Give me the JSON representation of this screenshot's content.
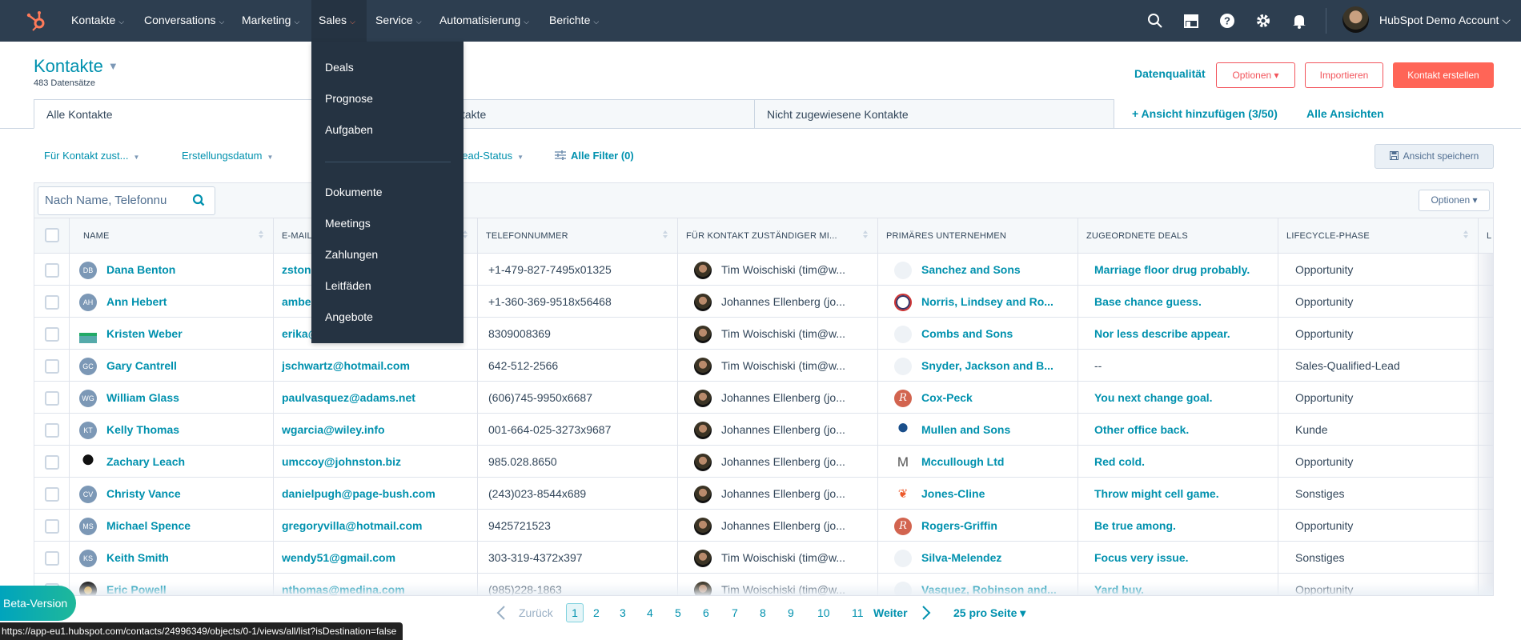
{
  "nav": {
    "items": [
      {
        "label": "Kontakte"
      },
      {
        "label": "Conversations"
      },
      {
        "label": "Marketing"
      },
      {
        "label": "Sales"
      },
      {
        "label": "Service"
      },
      {
        "label": "Automatisierung"
      },
      {
        "label": "Berichte"
      }
    ],
    "chevron": "⌵",
    "account": "HubSpot Demo Account ⌵",
    "icons": [
      "search-icon",
      "marketplace-icon",
      "help-icon",
      "settings-icon",
      "notifications-icon"
    ]
  },
  "sales_menu": {
    "group1": [
      "Deals",
      "Prognose",
      "Aufgaben"
    ],
    "group2": [
      "Dokumente",
      "Meetings",
      "Zahlungen",
      "Leitfäden",
      "Angebote"
    ]
  },
  "header": {
    "title": "Kontakte",
    "caret": "▼",
    "record_count": "483 Datensätze",
    "data_quality": "Datenqualität",
    "options": "Optionen ▾",
    "import": "Importieren",
    "create": "Kontakt erstellen"
  },
  "tabs": {
    "items": [
      "Alle Kontakte",
      "Meine Kontakte",
      "Nicht zugewiesene Kontakte"
    ],
    "add_view": "+  Ansicht hinzufügen (3/50)",
    "all_views": "Alle Ansichten"
  },
  "filters": {
    "items": [
      "Für Kontakt zust...",
      "Erstellungsdatum",
      "Lead-Status"
    ],
    "caret": "▼",
    "all_filters": "Alle Filter (0)",
    "save_view": "Ansicht speichern"
  },
  "table": {
    "search_placeholder": "Nach Name, Telefonnu",
    "options": "Optionen ▾",
    "columns": [
      "NAME",
      "E-MAIL",
      "TELEFONNUMMER",
      "FÜR KONTAKT ZUSTÄNDIGER MI...",
      "PRIMÄRES UNTERNEHMEN",
      "ZUGEORDNETE DEALS",
      "LIFECYCLE-PHASE",
      "L"
    ],
    "rows": [
      {
        "initials": "DB",
        "name": "Dana Benton",
        "email": "zstone@example.com",
        "phone": "+1-479-827-7495x01325",
        "owner": "Tim Woischiski (tim@w...",
        "company": "Sanchez and Sons",
        "deal": "Marriage floor drug probably.",
        "stage": "Opportunity"
      },
      {
        "initials": "AH",
        "name": "Ann Hebert",
        "email": "amber@example.com",
        "phone": "+1-360-369-9518x56468",
        "owner": "Johannes Ellenberg (jo...",
        "company": "Norris, Lindsey and Ro...",
        "deal": "Base chance guess.",
        "stage": "Opportunity"
      },
      {
        "initials": "",
        "name": "Kristen Weber",
        "email": "erika@example.com",
        "phone": "8309008369",
        "owner": "Tim Woischiski (tim@w...",
        "company": "Combs and Sons",
        "deal": "Nor less describe appear.",
        "stage": "Opportunity"
      },
      {
        "initials": "GC",
        "name": "Gary Cantrell",
        "email": "jschwartz@hotmail.com",
        "phone": "642-512-2566",
        "owner": "Tim Woischiski (tim@w...",
        "company": "Snyder, Jackson and B...",
        "deal": "--",
        "stage": "Sales-Qualified-Lead"
      },
      {
        "initials": "WG",
        "name": "William Glass",
        "email": "paulvasquez@adams.net",
        "phone": "(606)745-9950x6687",
        "owner": "Johannes Ellenberg (jo...",
        "company": "Cox-Peck",
        "deal": "You next change goal.",
        "stage": "Opportunity"
      },
      {
        "initials": "KT",
        "name": "Kelly Thomas",
        "email": "wgarcia@wiley.info",
        "phone": "001-664-025-3273x9687",
        "owner": "Johannes Ellenberg (jo...",
        "company": "Mullen and Sons",
        "deal": "Other office back.",
        "stage": "Kunde"
      },
      {
        "initials": "",
        "name": "Zachary Leach",
        "email": "umccoy@johnston.biz",
        "phone": "985.028.8650",
        "owner": "Johannes Ellenberg (jo...",
        "company": "Mccullough Ltd",
        "deal": "Red cold.",
        "stage": "Opportunity"
      },
      {
        "initials": "CV",
        "name": "Christy Vance",
        "email": "danielpugh@page-bush.com",
        "phone": "(243)023-8544x689",
        "owner": "Johannes Ellenberg (jo...",
        "company": "Jones-Cline",
        "deal": "Throw might cell game.",
        "stage": "Sonstiges"
      },
      {
        "initials": "MS",
        "name": "Michael Spence",
        "email": "gregoryvilla@hotmail.com",
        "phone": "9425721523",
        "owner": "Johannes Ellenberg (jo...",
        "company": "Rogers-Griffin",
        "deal": "Be true among.",
        "stage": "Opportunity"
      },
      {
        "initials": "KS",
        "name": "Keith Smith",
        "email": "wendy51@gmail.com",
        "phone": "303-319-4372x397",
        "owner": "Tim Woischiski (tim@w...",
        "company": "Silva-Melendez",
        "deal": "Focus very issue.",
        "stage": "Sonstiges"
      },
      {
        "initials": "",
        "name": "Eric Powell",
        "email": "nthomas@medina.com",
        "phone": "(985)228-1863",
        "owner": "Tim Woischiski (tim@w...",
        "company": "Vasquez, Robinson and...",
        "deal": "Yard buy.",
        "stage": "Opportunity"
      }
    ]
  },
  "pagination": {
    "prev": "Zurück",
    "pages": [
      "1",
      "2",
      "3",
      "4",
      "5",
      "6",
      "7",
      "8",
      "9",
      "10",
      "11"
    ],
    "current": "1",
    "next": "Weiter",
    "per_page": "25 pro Seite ▾"
  },
  "beta": "Beta-Version",
  "status_url": "https://app-eu1.hubspot.com/contacts/24996349/objects/0-1/views/all/list?isDestination=false",
  "colors": {
    "nav_bg": "#2d3e50",
    "accent": "#0091ae",
    "primary": "#ff6557"
  }
}
